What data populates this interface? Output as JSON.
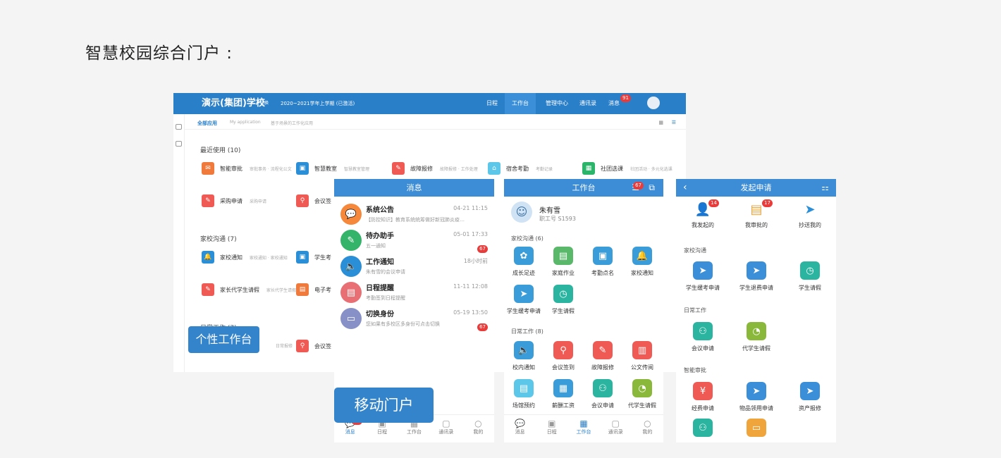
{
  "page_title": "智慧校园综合门户 :",
  "desktop": {
    "school_name": "演示(集团)学校",
    "switch_text": "切换",
    "semester": "2020~2021学年上学期 (已激活)",
    "nav": [
      "日程",
      "工作台",
      "管理中心",
      "通讯录",
      "消息"
    ],
    "nav_badge": "91",
    "subnav": {
      "all_apps": "全部应用",
      "my_app": "My application",
      "hint": "基于场景的工作化应用"
    },
    "recent_title": "最近使用 (10)",
    "recent_apps": [
      {
        "label": "智能审批",
        "desc": "审批事务 · 流程化公文",
        "color": "#f07a3c",
        "icon": "✉"
      },
      {
        "label": "智慧教室",
        "desc": "智慧教室管理",
        "color": "#2b8fd8",
        "icon": "▣"
      },
      {
        "label": "故障报修",
        "desc": "故障报修 · 工作处理",
        "color": "#ef5b54",
        "icon": "✎"
      },
      {
        "label": "宿舍考勤",
        "desc": "考勤记录",
        "color": "#5cc7e8",
        "icon": "⌂"
      },
      {
        "label": "社团选课",
        "desc": "社团活动 · 多元化选课",
        "color": "#2bb56a",
        "icon": "▦"
      },
      {
        "label": "采购申请",
        "desc": "采购申请",
        "color": "#ef5b54",
        "icon": "✎"
      },
      {
        "label": "会议签",
        "desc": "",
        "color": "#ef5b54",
        "icon": "⚲"
      }
    ],
    "home_school_title": "家校沟通 (7)",
    "home_school_apps": [
      {
        "label": "家校通知",
        "desc": "家校通知 · 家校通知",
        "color": "#2b8fd8",
        "icon": "🔔"
      },
      {
        "label": "学生考",
        "desc": "",
        "color": "#2b8fd8",
        "icon": "▣"
      },
      {
        "label": "家长代学生请假",
        "desc": "家长代学生请假",
        "color": "#ef5b54",
        "icon": "✎"
      },
      {
        "label": "电子考",
        "desc": "",
        "color": "#f07a3c",
        "icon": "▤"
      }
    ],
    "daily_title": "日常工作 (7)",
    "daily_apps": [
      {
        "label": "会议签",
        "desc": "",
        "color": "#ef5b54",
        "icon": "⚲"
      }
    ],
    "daily_desc": "日常报修"
  },
  "messages_panel": {
    "title": "消息",
    "items": [
      {
        "title": "系统公告",
        "sub": "【防控知识】教育系统统筹做好新冠肺炎疫…",
        "time": "04-21 11:15",
        "badge": "",
        "color": "#f5883a",
        "icon": "💬"
      },
      {
        "title": "待办助手",
        "sub": "五一通知",
        "time": "05-01 17:33",
        "badge": "67",
        "color": "#34b36a",
        "icon": "✎"
      },
      {
        "title": "工作通知",
        "sub": "朱有雪的会议申请",
        "time": "18小时前",
        "badge": "",
        "color": "#2b8fd8",
        "icon": "🔈"
      },
      {
        "title": "日程提醒",
        "sub": "考勤签到日程提醒",
        "time": "11-11 12:08",
        "badge": "",
        "color": "#e86f73",
        "icon": "▤"
      },
      {
        "title": "切换身份",
        "sub": "您如果有多校区多身份可点击切换",
        "time": "05-19 13:50",
        "badge": "67",
        "color": "#8891c7",
        "icon": "▭"
      }
    ],
    "tabs": [
      {
        "label": "消息",
        "glyph": "💬",
        "badge": "67",
        "active": true
      },
      {
        "label": "日程",
        "glyph": "▣",
        "badge": "",
        "active": false
      },
      {
        "label": "工作台",
        "glyph": "▦",
        "badge": "",
        "active": false
      },
      {
        "label": "通讯录",
        "glyph": "▢",
        "badge": "",
        "active": false
      },
      {
        "label": "我的",
        "glyph": "○",
        "badge": "",
        "active": false
      }
    ]
  },
  "workbench_panel": {
    "title": "工作台",
    "badge": "67",
    "user_name": "朱有雪",
    "user_id": "职工号 S1593",
    "group1": "家校沟通 (6)",
    "group1_items": [
      {
        "label": "成长足迹",
        "color": "#3a9cd8",
        "icon": "✿"
      },
      {
        "label": "家庭作业",
        "color": "#5ab86a",
        "icon": "▤"
      },
      {
        "label": "考勤点名",
        "color": "#3a9cd8",
        "icon": "▣"
      },
      {
        "label": "家校通知",
        "color": "#3a9cd8",
        "icon": "🔔"
      },
      {
        "label": "学生缓考申请",
        "color": "#3a9cd8",
        "icon": "➤"
      },
      {
        "label": "学生请假",
        "color": "#2bb5a0",
        "icon": "◷"
      }
    ],
    "group2": "日常工作 (8)",
    "group2_items": [
      {
        "label": "校内通知",
        "color": "#3a9cd8",
        "icon": "🔈"
      },
      {
        "label": "会议签到",
        "color": "#ef5b54",
        "icon": "⚲"
      },
      {
        "label": "故障报修",
        "color": "#ef5b54",
        "icon": "✎"
      },
      {
        "label": "公文传阅",
        "color": "#ef5b54",
        "icon": "▥"
      },
      {
        "label": "场馆预约",
        "color": "#5cc7e8",
        "icon": "▤"
      },
      {
        "label": "薪酬工资",
        "color": "#3a9cd8",
        "icon": "▦"
      },
      {
        "label": "会议申请",
        "color": "#2bb5a0",
        "icon": "⚇"
      },
      {
        "label": "代学生请假",
        "color": "#8ab83a",
        "icon": "◔"
      }
    ],
    "tabs": [
      {
        "label": "消息",
        "glyph": "💬",
        "badge": "",
        "active": false
      },
      {
        "label": "日程",
        "glyph": "▣",
        "badge": "",
        "active": false
      },
      {
        "label": "工作台",
        "glyph": "▦",
        "badge": "",
        "active": true
      },
      {
        "label": "通讯录",
        "glyph": "▢",
        "badge": "",
        "active": false
      },
      {
        "label": "我的",
        "glyph": "○",
        "badge": "",
        "active": false
      }
    ]
  },
  "apply_panel": {
    "title": "发起申请",
    "top": [
      {
        "label": "我发起的",
        "badge": "14",
        "color": "#e94a4a",
        "icon": "👤"
      },
      {
        "label": "我审批的",
        "badge": "17",
        "color": "#f0a43c",
        "icon": "▤"
      },
      {
        "label": "抄送我的",
        "badge": "",
        "color": "#2b8fd8",
        "icon": "➤"
      }
    ],
    "g1": "家校沟通",
    "g1_items": [
      {
        "label": "学生缓考申请",
        "color": "#3a8fd8",
        "icon": "➤"
      },
      {
        "label": "学生退费申请",
        "color": "#3a8fd8",
        "icon": "➤"
      },
      {
        "label": "学生请假",
        "color": "#2bb5a0",
        "icon": "◷"
      }
    ],
    "g2": "日常工作",
    "g2_items": [
      {
        "label": "会议申请",
        "color": "#2bb5a0",
        "icon": "⚇"
      },
      {
        "label": "代学生请假",
        "color": "#8ab83a",
        "icon": "◔"
      }
    ],
    "g3": "智能审批",
    "g3_items": [
      {
        "label": "经费申请",
        "color": "#ef5b54",
        "icon": "¥"
      },
      {
        "label": "物品领用申请",
        "color": "#3a8fd8",
        "icon": "➤"
      },
      {
        "label": "资产报修",
        "color": "#3a8fd8",
        "icon": "➤"
      },
      {
        "label": "",
        "color": "#2bb5a0",
        "icon": "⚇"
      },
      {
        "label": "",
        "color": "#f0a43c",
        "icon": "▭"
      }
    ]
  },
  "labels": {
    "personal": "个性工作台",
    "mobile": "移动门户"
  }
}
